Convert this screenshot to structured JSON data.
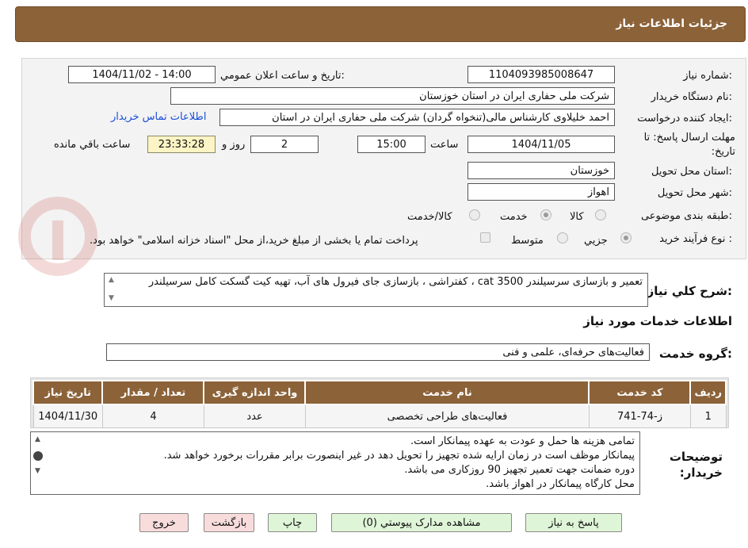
{
  "header": {
    "title": "جزئیات اطلاعات نیاز"
  },
  "form": {
    "need_number_label": "شماره نیاز:",
    "need_number": "1104093985008647",
    "announce_label": "تاریخ و ساعت اعلان عمومي:",
    "announce_value": "1404/11/02 - 14:00",
    "buyer_org_label": "نام دستگاه خریدار:",
    "buyer_org": "شرکت ملی حفاری ایران در استان خوزستان",
    "requester_label": "ایجاد کننده درخواست:",
    "requester": "احمد خلیلاوی کارشناس مالی(تنخواه گردان) شرکت ملی حفاری ایران در استان",
    "contact_link": "اطلاعات تماس خریدار",
    "deadline_label": "مهلت ارسال پاسخ: تا تاریخ:",
    "deadline_date": "1404/11/05",
    "time_label": "ساعت",
    "deadline_time": "15:00",
    "days": "2",
    "days_label": "روز و",
    "remaining_time": "23:33:28",
    "remaining_label": "ساعت باقي مانده",
    "province_label": "استان محل تحویل:",
    "province": "خوزستان",
    "city_label": "شهر محل تحویل:",
    "city": "اهواز",
    "category_label": "طبقه بندی موضوعی:",
    "category_options": [
      "کالا",
      "خدمت",
      "کالا/خدمت"
    ],
    "category_selected": "خدمت",
    "process_label": "نوع فرآیند خرید :",
    "process_options": [
      "جزيي",
      "متوسط"
    ],
    "process_selected": "جزيي",
    "payment_note": "پرداخت تمام یا بخشی از مبلغ خرید،از محل \"اسناد خزانه اسلامی\" خواهد بود."
  },
  "summary": {
    "label": "شرح کلي نياز:",
    "text": "تعمیر و بازسازی سرسیلندر cat 3500 ، کفتراشی ، بازسازی جای فیرول های آب، تهیه کیت گسکت کامل سرسیلندر"
  },
  "services": {
    "section_title": "اطلاعات خدمات مورد نياز",
    "group_label": "گروه خدمت:",
    "group_value": "فعالیت‌های حرفه‌ای، علمی و فنی",
    "columns": [
      "رديف",
      "کد خدمت",
      "نام خدمت",
      "واحد اندازه گيری",
      "تعداد / مقدار",
      "تاريخ نياز"
    ],
    "rows": [
      {
        "index": "1",
        "code": "ز-74-741",
        "name": "فعالیت‌های طراحی تخصصی",
        "unit": "عدد",
        "qty": "4",
        "date": "1404/11/30"
      }
    ]
  },
  "notes": {
    "label": "توضیحات خریدار:",
    "lines": [
      "تمامی هزینه ها حمل و عودت به عهده پیمانکار است.",
      "پیمانکار موظف است در زمان ارایه شده تجهیز را تحویل دهد در غیر اینصورت برابر مقررات برخورد خواهد شد.",
      "دوره ضمانت جهت تعمیر تجهیز  90 روزکاری می باشد.",
      "محل کارگاه پیمانکار در اهواز باشد."
    ]
  },
  "buttons": {
    "reply": "پاسخ به نیاز",
    "documents": "مشاهده مدارک پیوستي (0)",
    "print": "چاپ",
    "back": "بازگشت",
    "exit": "خروج"
  },
  "colors": {
    "header": "#8c6239",
    "remaining": "#fcf4c4",
    "green_button": "#dff5d8",
    "red_button": "#f8dcdc"
  }
}
